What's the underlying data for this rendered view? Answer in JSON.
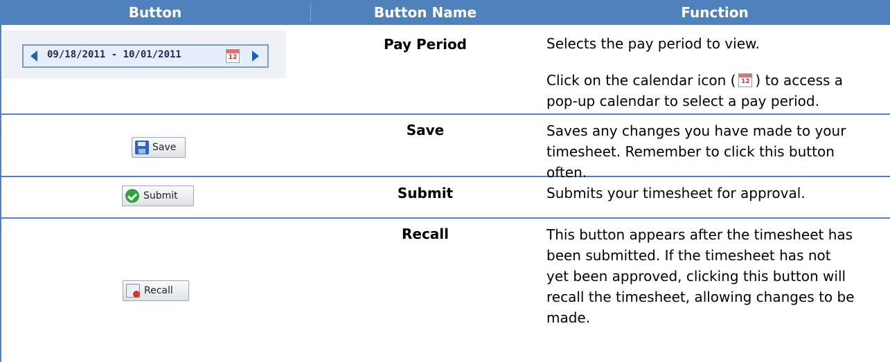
{
  "header": {
    "col_button": "Button",
    "col_name": "Button Name",
    "col_function": "Function"
  },
  "rows": [
    {
      "name": "Pay Period",
      "widget": {
        "date_range": "09/18/2011 - 10/01/2011",
        "calendar_day": "12"
      },
      "function_line1": "Selects the pay period to view.",
      "function_line2_before": "Click on the calendar icon (",
      "function_line2_after": ") to access a",
      "function_line3": "pop-up calendar to select a pay period."
    },
    {
      "name": "Save",
      "button_label": "Save",
      "function_lines": [
        "Saves any changes you have made to your",
        "timesheet.  Remember to click this button",
        "often."
      ]
    },
    {
      "name": "Submit",
      "button_label": "Submit",
      "function_lines": [
        "Submits your timesheet for approval."
      ]
    },
    {
      "name": "Recall",
      "button_label": "Recall",
      "function_lines": [
        "This button appears after the timesheet has",
        "been submitted.  If the timesheet has not",
        "yet been approved, clicking this button will",
        "recall the timesheet, allowing changes to be",
        "made."
      ]
    }
  ],
  "colors": {
    "header_bg": "#4f81bd",
    "grid": "#4f81bd",
    "header_text": "#ffffff"
  }
}
